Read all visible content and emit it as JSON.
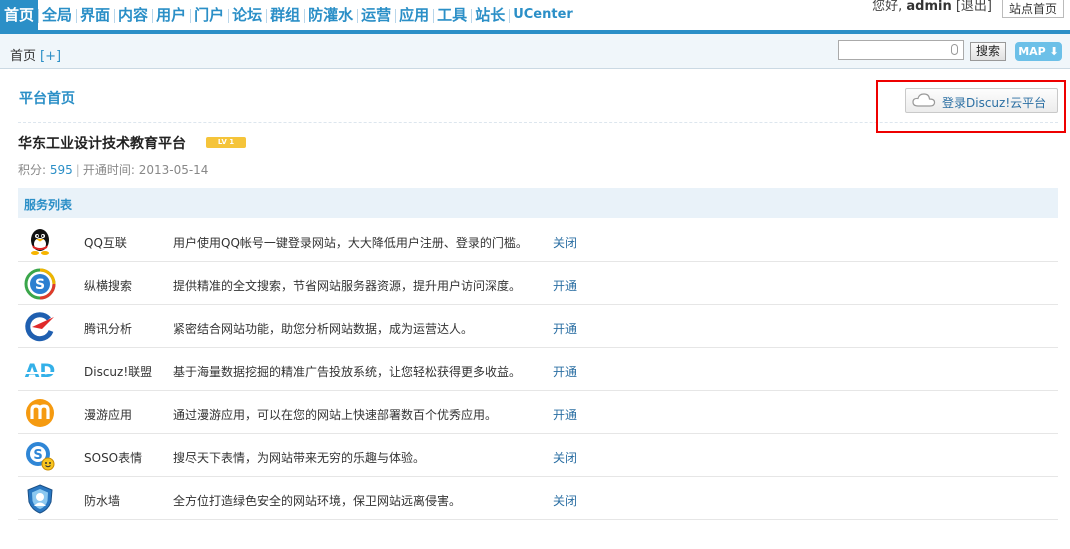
{
  "nav": {
    "items": [
      "首页",
      "全局",
      "界面",
      "内容",
      "用户",
      "门户",
      "论坛",
      "群组",
      "防灌水",
      "运营",
      "应用",
      "工具",
      "站长",
      "UCenter"
    ],
    "greeting": "您好,",
    "username": "admin",
    "logout": "[退出]",
    "site_home": "站点首页"
  },
  "subbar": {
    "breadcrumb": "首页",
    "add": "[+]",
    "search_placeholder": "",
    "search_button": "搜索",
    "map_button": "MAP ⬇"
  },
  "main": {
    "title": "平台首页",
    "cloud_button": "登录Discuz!云平台",
    "site_name": "华东工业设计技术教育平台",
    "level_badge": "LV 1",
    "points_label": "积分:",
    "points": "595",
    "open_label": "开通时间:",
    "open_date": "2013-05-14",
    "service_header": "服务列表"
  },
  "services": [
    {
      "icon": "qq-icon",
      "name": "QQ互联",
      "desc": "用户使用QQ帐号一键登录网站，大大降低用户注册、登录的门槛。",
      "action": "关闭"
    },
    {
      "icon": "search-s-icon",
      "name": "纵横搜索",
      "desc": "提供精准的全文搜索，节省网站服务器资源，提升用户访问深度。",
      "action": "开通"
    },
    {
      "icon": "tencent-analysis-icon",
      "name": "腾讯分析",
      "desc": "紧密结合网站功能，助您分析网站数据，成为运营达人。",
      "action": "开通"
    },
    {
      "icon": "ad-icon",
      "name": "Discuz!联盟",
      "desc": "基于海量数据挖掘的精准广告投放系统，让您轻松获得更多收益。",
      "action": "开通"
    },
    {
      "icon": "manyou-icon",
      "name": "漫游应用",
      "desc": "通过漫游应用，可以在您的网站上快速部署数百个优秀应用。",
      "action": "开通"
    },
    {
      "icon": "soso-emoticon-icon",
      "name": "SOSO表情",
      "desc": "搜尽天下表情，为网站带来无穷的乐趣与体验。",
      "action": "关闭"
    },
    {
      "icon": "firewall-shield-icon",
      "name": "防水墙",
      "desc": "全方位打造绿色安全的网站环境，保卫网站远离侵害。",
      "action": "关闭"
    }
  ],
  "colors": {
    "accent": "#2b8fc7",
    "highlight_border": "#e00000"
  }
}
